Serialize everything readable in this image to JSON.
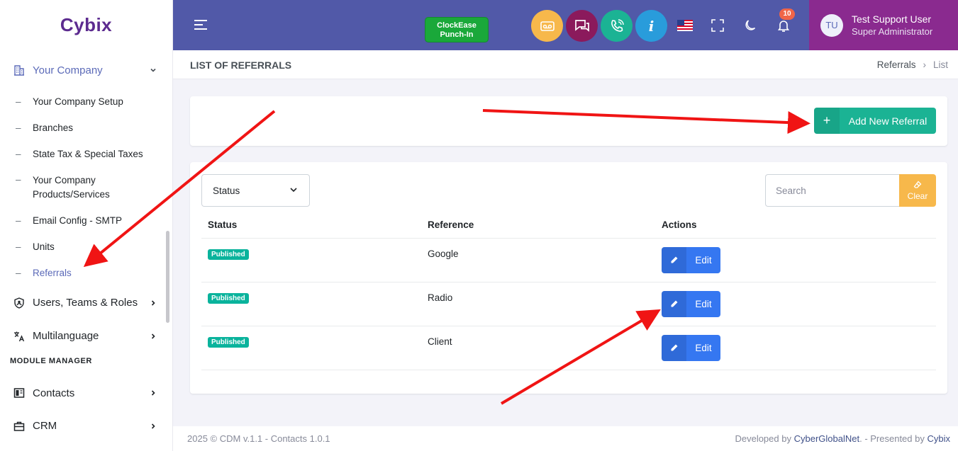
{
  "sidebar": {
    "logo": "Cybix",
    "company": {
      "label": "Your Company"
    },
    "subitems": [
      "Your Company Setup",
      "Branches",
      "State Tax & Special Taxes",
      "Your Company Products/Services",
      "Email Config - SMTP",
      "Units",
      "Referrals"
    ],
    "users": "Users, Teams & Roles",
    "multilanguage": "Multilanguage",
    "section_title": "MODULE MANAGER",
    "contacts": "Contacts",
    "crm": "CRM"
  },
  "topbar": {
    "clock_line1": "ClockEase",
    "clock_line2": "Punch-In",
    "notification_count": "10",
    "user_initials": "TU",
    "user_name": "Test Support User",
    "user_role": "Super Administrator",
    "colors": {
      "voicemail": "#f7b84b",
      "chat": "#8b1a5c",
      "phone": "#1bb394",
      "info": "#299cdb"
    }
  },
  "page": {
    "title": "LIST OF REFERRALS",
    "breadcrumb": [
      "Referrals",
      "List"
    ],
    "add_button": "Add New Referral",
    "status_select": "Status",
    "search_placeholder": "Search",
    "clear_label": "Clear",
    "columns": [
      "Status",
      "Reference",
      "Actions"
    ],
    "rows": [
      {
        "status": "Published",
        "reference": "Google",
        "action": "Edit"
      },
      {
        "status": "Published",
        "reference": "Radio",
        "action": "Edit"
      },
      {
        "status": "Published",
        "reference": "Client",
        "action": "Edit"
      }
    ]
  },
  "footer": {
    "left": "2025 © CDM v.1.1 - Contacts 1.0.1",
    "right_prefix": "Developed by ",
    "right_brand1": "CyberGlobalNet",
    "right_mid": ". - Presented by ",
    "right_brand2": "Cybix"
  }
}
